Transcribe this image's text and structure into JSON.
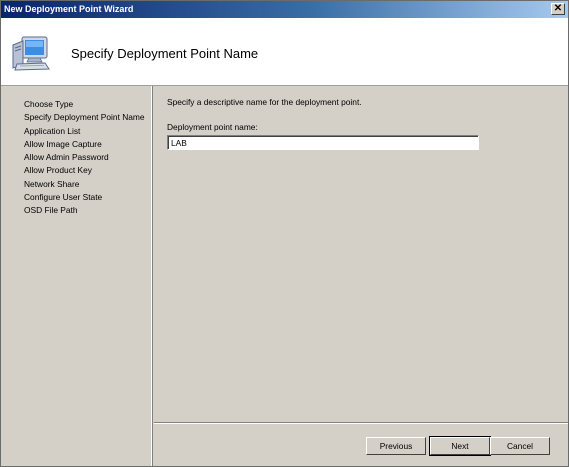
{
  "window": {
    "title": "New Deployment Point Wizard",
    "close_glyph": "✕"
  },
  "header": {
    "title": "Specify Deployment Point Name",
    "icon": "computer-icon"
  },
  "nav": {
    "items": [
      "Choose Type",
      "Specify Deployment Point Name",
      "Application List",
      "Allow Image Capture",
      "Allow Admin Password",
      "Allow Product Key",
      "Network Share",
      "Configure User State",
      "OSD File Path"
    ]
  },
  "content": {
    "instructions": "Specify a descriptive name for the deployment point.",
    "field_label": "Deployment point name:",
    "field_value": "LAB"
  },
  "footer": {
    "previous_label": "Previous",
    "next_label": "Next",
    "cancel_label": "Cancel"
  }
}
